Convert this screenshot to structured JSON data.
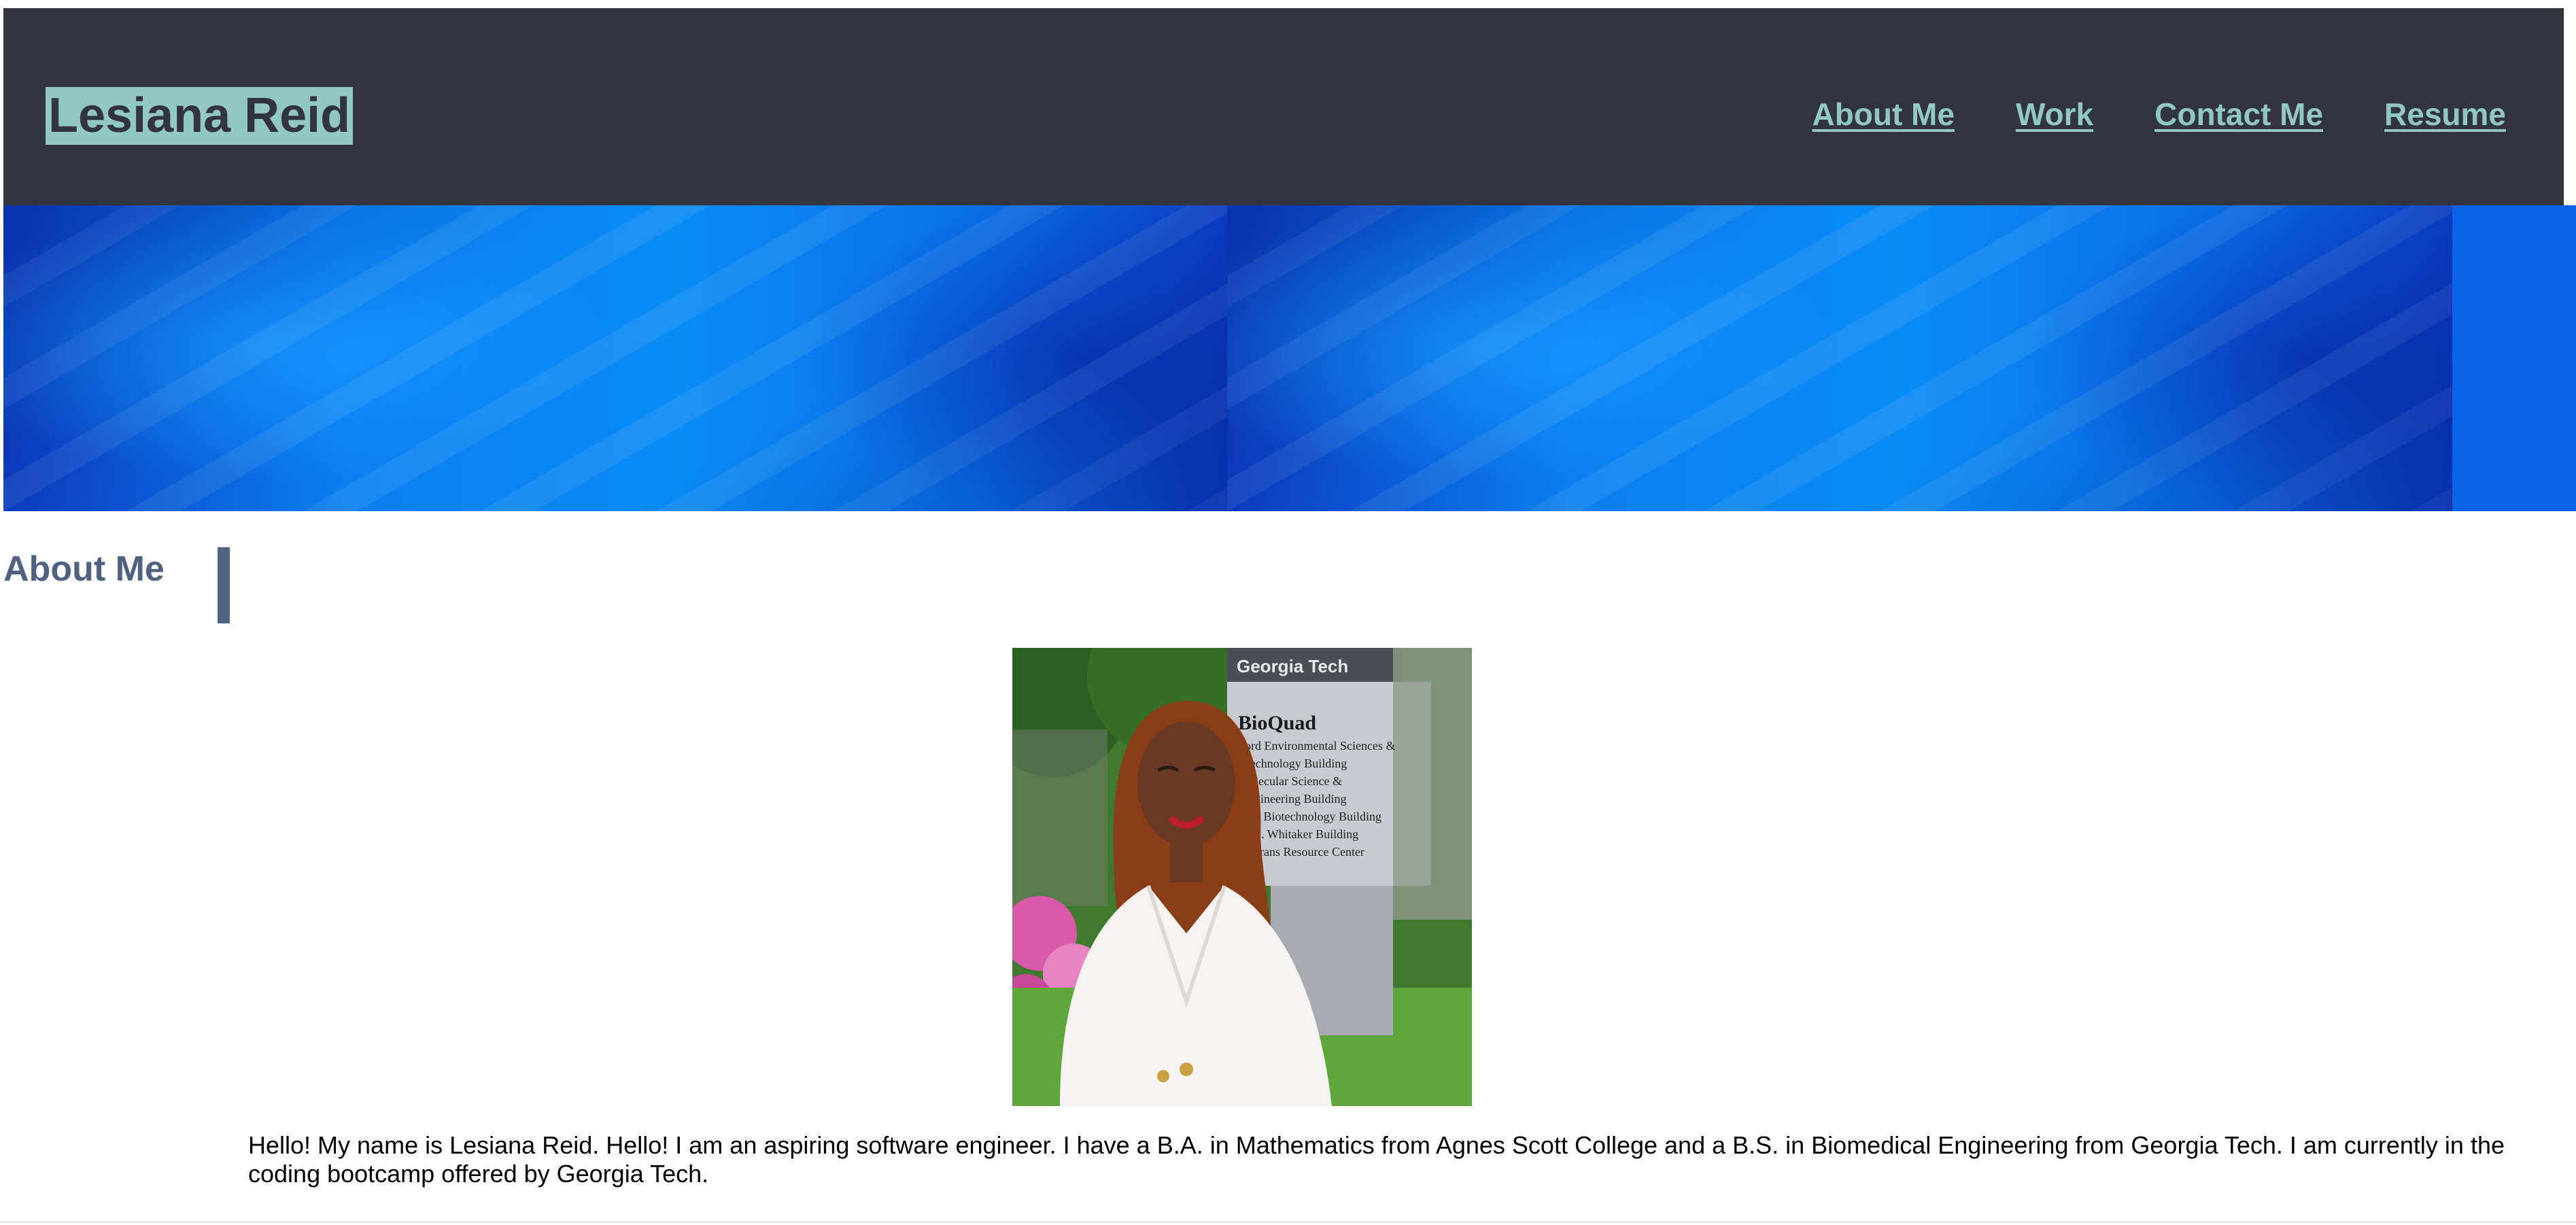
{
  "header": {
    "brand": "Lesiana Reid",
    "nav": [
      {
        "label": "About Me"
      },
      {
        "label": "Work"
      },
      {
        "label": "Contact Me"
      },
      {
        "label": "Resume"
      }
    ]
  },
  "about": {
    "heading": "About Me",
    "photo": {
      "sign_header": "Georgia Tech",
      "sign_title": "BioQuad",
      "sign_lines": [
        "Ford Environmental Sciences &",
        "Technology Building",
        "Molecular Science &",
        "Engineering Building",
        "Petit Biotechnology Building",
        "U. A. Whitaker Building",
        "Veterans Resource Center"
      ]
    },
    "bio": "Hello! My name is Lesiana Reid. Hello! I am an aspiring software engineer. I have a B.A. in Mathematics from Agnes Scott College and a B.S. in Biomedical Engineering from Georgia Tech. I am currently in the coding bootcamp offered by Georgia Tech."
  },
  "colors": {
    "header_bg": "#33353e",
    "accent": "#92c8c2",
    "heading": "#506280",
    "hero": "#0a8cf5"
  }
}
